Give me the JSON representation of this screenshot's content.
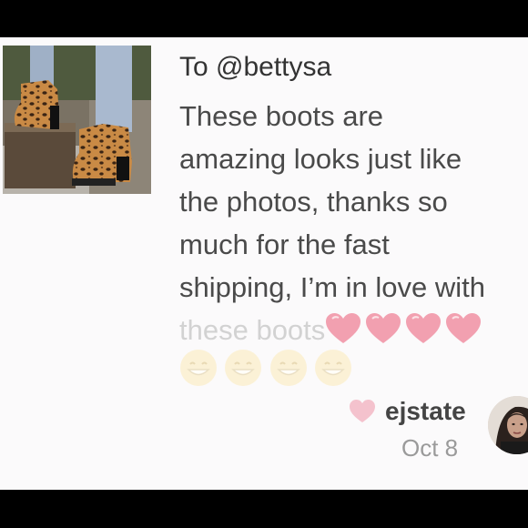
{
  "comment": {
    "recipient": "To @bettysa",
    "message_lines": [
      "These boots are",
      "amazing looks just like",
      "the photos, thanks so",
      "much for the fast",
      "shipping, I’m in love with",
      "these boots"
    ],
    "trailing_emojis": [
      "heart-emoji",
      "heart-emoji",
      "heart-emoji",
      "heart-emoji"
    ],
    "emoji_row": [
      "grinning-face-emoji",
      "grinning-face-emoji",
      "grinning-face-emoji",
      "grinning-face-emoji"
    ],
    "username": "ejstate",
    "date": "Oct 8"
  },
  "colors": {
    "background": "#fbfafb",
    "text": "#4a4a4a",
    "heart": "#f2a0b0",
    "muted": "#9a9a9a"
  },
  "icons": {
    "like": "heart-icon",
    "photo": "leopard-boots-photo",
    "avatar": "user-avatar"
  }
}
